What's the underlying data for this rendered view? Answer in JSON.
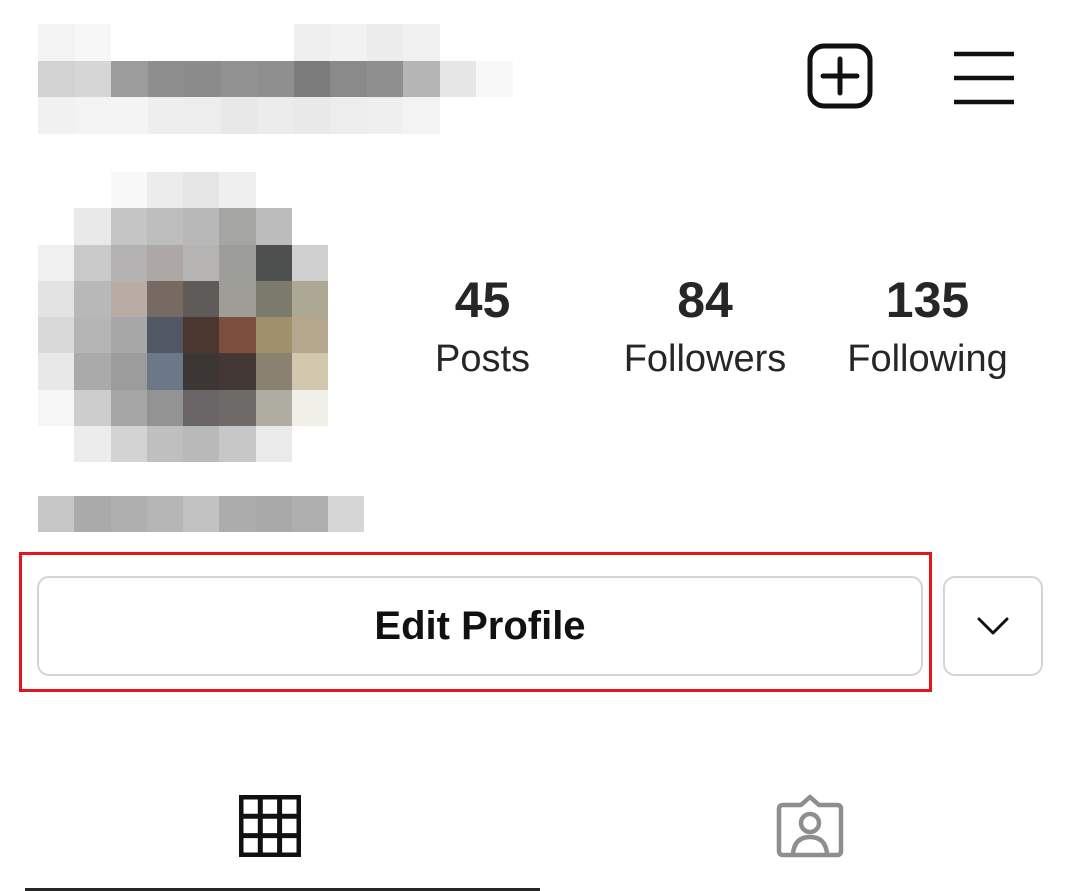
{
  "header": {
    "new_post_icon": "plus-square-icon",
    "menu_icon": "hamburger-menu-icon"
  },
  "stats": {
    "posts": {
      "count": "45",
      "label": "Posts"
    },
    "followers": {
      "count": "84",
      "label": "Followers"
    },
    "following": {
      "count": "135",
      "label": "Following"
    }
  },
  "actions": {
    "edit_profile_label": "Edit Profile",
    "dropdown_icon": "chevron-down-icon",
    "highlight_color": "#e3141b"
  },
  "tabs": [
    {
      "icon": "grid-icon",
      "active": true
    },
    {
      "icon": "tagged-person-icon",
      "active": false
    }
  ],
  "colors": {
    "text": "#262626",
    "border": "#d4d4d4",
    "inactive_icon": "#8e8e8e"
  }
}
